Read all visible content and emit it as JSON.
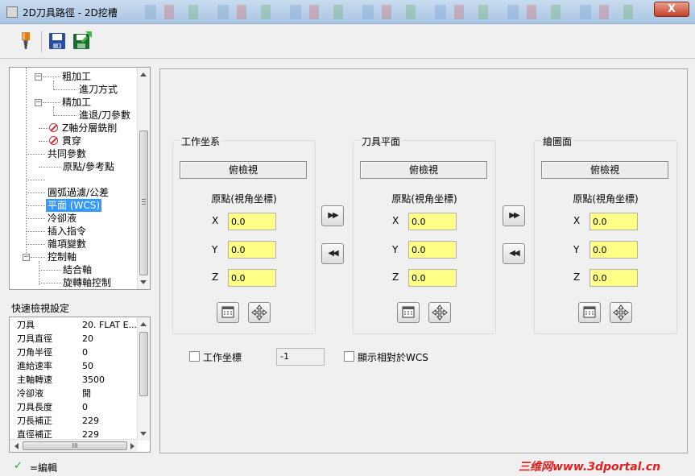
{
  "window": {
    "title": "2D刀具路徑 - 2D挖槽",
    "close_label": "X"
  },
  "tree": {
    "items": [
      {
        "label": "粗加工"
      },
      {
        "label": "進刀方式"
      },
      {
        "label": "精加工"
      },
      {
        "label": "進退/刀參數"
      },
      {
        "label": "Z軸分層銑削"
      },
      {
        "label": "貫穿"
      },
      {
        "label": "共同參數"
      },
      {
        "label": "原點/參考點"
      },
      {
        "label": "圓弧過濾/公差"
      },
      {
        "label": "平面 (WCS)"
      },
      {
        "label": "冷卻液"
      },
      {
        "label": "插入指令"
      },
      {
        "label": "雜項變數"
      },
      {
        "label": "控制軸"
      },
      {
        "label": "結合軸"
      },
      {
        "label": "旋轉軸控制"
      }
    ]
  },
  "quick_view": {
    "title": "快速檢視設定",
    "rows": [
      {
        "key": "刀具",
        "value": "20. FLAT E..."
      },
      {
        "key": "刀具直徑",
        "value": "20"
      },
      {
        "key": "刀角半徑",
        "value": "0"
      },
      {
        "key": "進給速率",
        "value": "50"
      },
      {
        "key": "主軸轉速",
        "value": "3500"
      },
      {
        "key": "冷卻液",
        "value": "開"
      },
      {
        "key": "刀具長度",
        "value": "0"
      },
      {
        "key": "刀長補正",
        "value": "229"
      },
      {
        "key": "直徑補正",
        "value": "229"
      }
    ],
    "scroll_grip": "III"
  },
  "status": {
    "label": "=編輯"
  },
  "panel": {
    "groups": [
      {
        "title": "工作坐系",
        "view": "俯檢視",
        "origin_label": "原點(視角坐標)",
        "x": "0.0",
        "y": "0.0",
        "z": "0.0"
      },
      {
        "title": "刀具平面",
        "view": "俯檢視",
        "origin_label": "原點(視角坐標)",
        "x": "0.0",
        "y": "0.0",
        "z": "0.0"
      },
      {
        "title": "繪圖面",
        "view": "俯檢視",
        "origin_label": "原點(視角坐標)",
        "x": "0.0",
        "y": "0.0",
        "z": "0.0"
      }
    ],
    "axis_labels": {
      "x": "X",
      "y": "Y",
      "z": "Z"
    },
    "copy_right": "▶▶",
    "copy_left": "◀◀",
    "wcs_checkbox_label": "工作坐標",
    "wcs_value": "-1",
    "relative_checkbox_label": "顯示相對於WCS"
  },
  "watermark": "三维网www.3dportal.cn",
  "colors": {
    "input_bg": "#ffff88",
    "selected": "#3399ff",
    "close": "#c7402a",
    "watermark": "#e02020"
  }
}
